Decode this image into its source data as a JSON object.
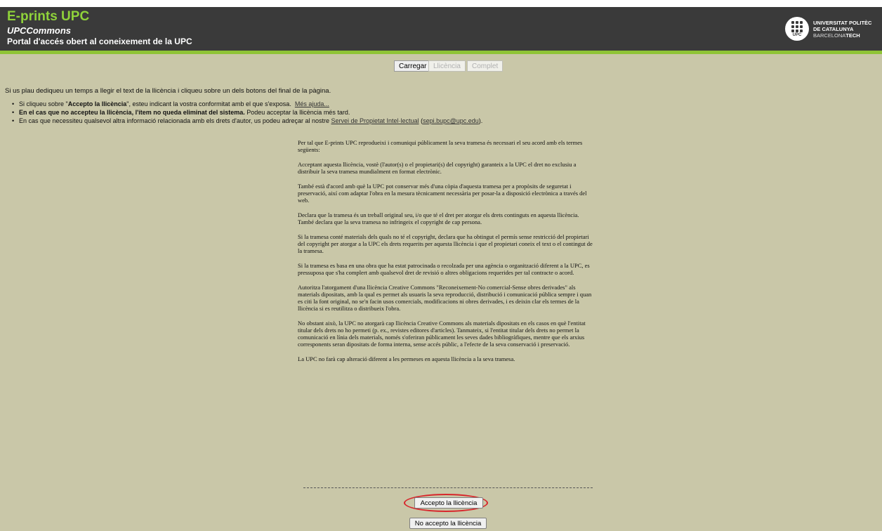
{
  "header": {
    "site_title": "E-prints UPC",
    "subtitle_prefix": "UPC",
    "subtitle_suffix": "ommons",
    "tagline": "Portal d'accés obert al coneixement de la UPC",
    "logo": {
      "abbr": "UPC",
      "line1": "UNIVERSITAT POLITÈC",
      "line2": "DE CATALUNYA",
      "line3_light": "BARCELONA",
      "line3_bold": "TECH"
    }
  },
  "steps": [
    "Carregar",
    "Llicència",
    "Complet"
  ],
  "intro": "Si us plau dediqueu un temps a llegir el text de la llicència i cliqueu sobre un dels botons del final de la pàgina.",
  "bullets": {
    "b1_pre": "Si cliqueu sobre \"",
    "b1_bold": "Accepto la llicència",
    "b1_post": "\", esteu indicant la vostra conformitat amb el que s'exposa.",
    "b1_link": "Més ajuda...",
    "b2_bold": "En el cas que no accepteu la llicència, l'ítem no queda eliminat del sistema.",
    "b2_post": " Podeu acceptar la llicència més tard.",
    "b3_pre": "En cas que necessiteu qualsevol altra informació relacionada amb els drets d'autor, us podeu adreçar al nostre ",
    "b3_link": "Servei de Propietat Intel·lectual",
    "b3_mid": " (",
    "b3_email": "sepi.bupc@upc.edu",
    "b3_end": ")."
  },
  "license_paragraphs": [
    "Per tal que E-prints UPC reprodueixi i comuniqui públicament la seva tramesa és necessari el seu acord amb els termes següents:",
    "Acceptant aquesta llicència, vostè (l'autor(s) o el propietari(s) del copyright) garanteix a la UPC el dret no exclusiu a distribuir la seva tramesa mundialment en format electrònic.",
    "També està d'acord amb què la UPC pot conservar més d'una còpia d'aquesta tramesa per a propòsits de seguretat i preservació, així com adaptar l'obra en la mesura tècnicament necessària per posar-la a disposició electrònica a través del web.",
    "Declara que la tramesa és un treball original seu, i/o que té el dret per atorgar els drets continguts en aquesta llicència. També declara que la seva tramesa no infringeix el copyright de cap persona.",
    "Si la tramesa conté materials dels quals no té el copyright, declara que ha obtingut el permís sense restricció del propietari del copyright per atorgar a la UPC els drets requerits per aquesta llicència i que el propietari coneix el text o el contingut de la tramesa.",
    "Si la tramesa es basa en una obra que ha estat patrocinada o recolzada per una agència o organització diferent a la UPC, es pressuposa que s'ha complert amb qualsevol dret de revisió o altres obligacions requerides per tal contracte o acord.",
    "Autoritza l'atorgament d'una llicència Creative Commons \"Reconeixement-No comercial-Sense obres derivades\" als materials dipositats, amb la qual es permet als usuaris la seva reproducció, distribució i comunicació pública sempre i quan es citi la font original, no se'n facin usos comercials, modificacions ni obres derivades, i es deixin clar els termes de la llicència si es reutilitza o distribueix l'obra.",
    "No obstant això, la UPC no atorgarà cap llicència Creative Commons als materials dipositats en els casos en què l'entitat titular dels drets no ho permeti (p. ex., revistes editores d'articles). Tanmateix, si l'entitat titular dels drets no permet la comunicació en línia dels materials, només s'oferiran públicament les seves dades bibliogràfiques, mentre que els arxius corresponents seran dipositats de forma interna, sense accés públic, a l'efecte de la seva conservació i preservació.",
    "La UPC no farà cap alteració diferent a les permeses en aquesta llicència a la seva tramesa."
  ],
  "buttons": {
    "accept": "Accepto la llicència",
    "decline": "No accepto la llicència"
  },
  "colors": {
    "header_bg": "#3a3a3a",
    "brand_green": "#8fd23a",
    "page_bg": "#c9c7a8",
    "highlight_red": "#d8262c"
  }
}
